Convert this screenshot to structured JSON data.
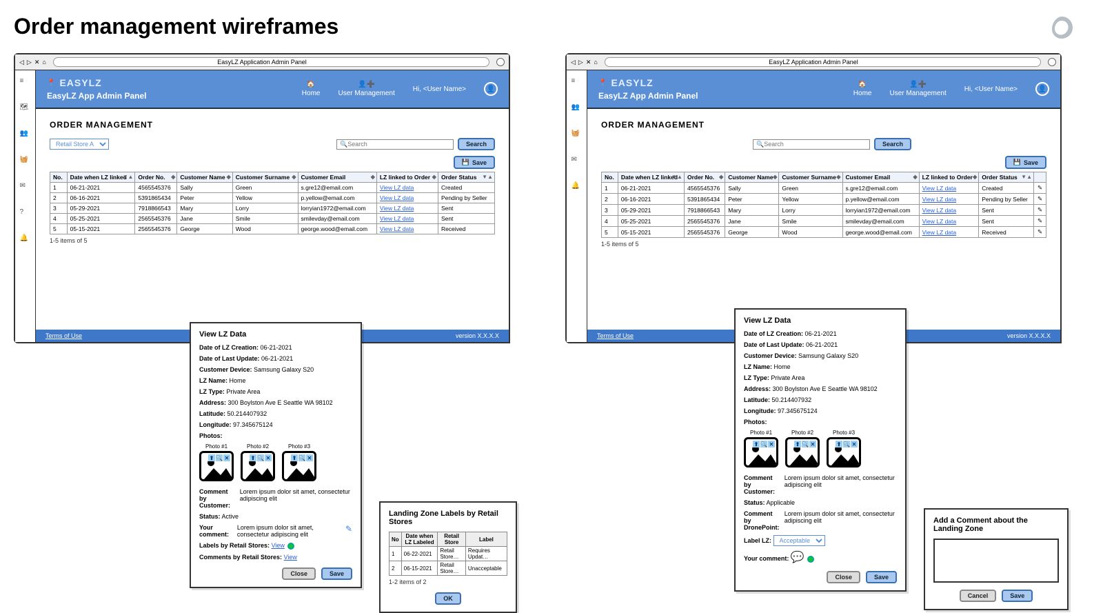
{
  "page_title": "Order management wireframes",
  "browser_title": "EasyLZ Application Admin Panel",
  "brand": "EASYLZ",
  "panel_label": "EasyLZ App Admin Panel",
  "nav": {
    "home": "Home",
    "user_mgmt": "User Management",
    "greeting": "Hi, <User Name>"
  },
  "section_title": "ORDER MANAGEMENT",
  "store_select": "Retail Store A",
  "search_placeholder": "Search",
  "search_btn": "Search",
  "save_btn": "Save",
  "footer": {
    "terms": "Terms of Use",
    "version": "version X.X.X.X"
  },
  "columns": {
    "no": "No.",
    "date": "Date when LZ linked",
    "order": "Order No.",
    "cname": "Customer Name",
    "csurname": "Customer Surname",
    "cemail": "Customer Email",
    "lz": "LZ linked to Order",
    "status": "Order Status"
  },
  "view_link": "View LZ data",
  "rows": [
    {
      "n": "1",
      "date": "06-21-2021",
      "order": "4565545376",
      "name": "Sally",
      "surname": "Green",
      "email": "s.gre12@email.com",
      "status": "Created"
    },
    {
      "n": "2",
      "date": "06-16-2021",
      "order": "5391865434",
      "name": "Peter",
      "surname": "Yellow",
      "email": "p.yellow@email.com",
      "status": "Pending by Seller"
    },
    {
      "n": "3",
      "date": "05-29-2021",
      "order": "7918866543",
      "name": "Mary",
      "surname": "Lorry",
      "email": "lorryian1972@email.com",
      "status": "Sent"
    },
    {
      "n": "4",
      "date": "05-25-2021",
      "order": "2565545376",
      "name": "Jane",
      "surname": "Smile",
      "email": "smilevday@email.com",
      "status": "Sent"
    },
    {
      "n": "5",
      "date": "05-15-2021",
      "order": "2565545376",
      "name": "George",
      "surname": "Wood",
      "email": "george.wood@email.com",
      "status": "Received"
    }
  ],
  "counter": "1-5 items of 5",
  "lz_popover": {
    "title": "View LZ Data",
    "date_creation_label": "Date of LZ Creation:",
    "date_creation": "06-21-2021",
    "date_update_label": "Date of Last Update:",
    "date_update": "06-21-2021",
    "device_label": "Customer Device:",
    "device": "Samsung Galaxy S20",
    "name_label": "LZ Name:",
    "name": "Home",
    "type_label": "LZ Type:",
    "type": "Private Area",
    "address_label": "Address:",
    "address": "300 Boylston Ave E Seattle WA 98102",
    "lat_label": "Latitude:",
    "lat": "50.214407932",
    "lon_label": "Longitude:",
    "lon": "97.345675124",
    "photos_label": "Photos:",
    "photo_labels": [
      "Photo #1",
      "Photo #2",
      "Photo #3"
    ],
    "comment_cust_label": "Comment by Customer:",
    "comment_cust": "Lorem ipsum dolor sit amet, consectetur adipiscing elit",
    "status_label": "Status:",
    "status_a": "Active",
    "status_b": "Applicable",
    "your_comment_label": "Your comment:",
    "your_comment": "Lorem ipsum dolor sit amet, consectetur adipiscing elit",
    "labels_by_label": "Labels by Retail Stores:",
    "labels_by_value": "View",
    "comments_by_label": "Comments by Retail Stores:",
    "comments_by_value": "View",
    "comment_dp_label": "Comment by DronePoint:",
    "label_lz_label": "Label LZ:",
    "label_lz_value": "Acceptable",
    "close": "Close",
    "save": "Save"
  },
  "labels_popover": {
    "title": "Landing Zone Labels by Retail Stores",
    "col_no": "No",
    "col_date": "Date when LZ Labeled",
    "col_store": "Retail Store",
    "col_label": "Label",
    "rows": [
      {
        "n": "1",
        "date": "06-22-2021",
        "store": "Retail Store…",
        "label": "Requires Updat…"
      },
      {
        "n": "2",
        "date": "06-15-2021",
        "store": "Retail Store…",
        "label": "Unacceptable"
      }
    ],
    "counter": "1-2 items of 2",
    "ok": "OK"
  },
  "comment_modal": {
    "title": "Add a Comment about the Landing Zone",
    "cancel": "Cancel",
    "save": "Save"
  }
}
